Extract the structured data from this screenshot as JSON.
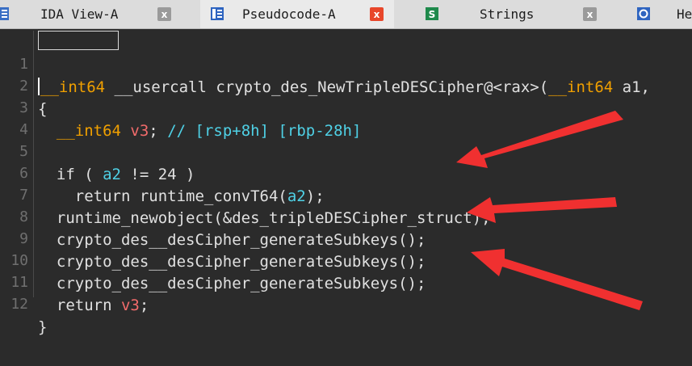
{
  "tabs": [
    {
      "label": "IDA View-A",
      "icon": "disassembly-icon",
      "close": "x",
      "active": false
    },
    {
      "label": "Pseudocode-A",
      "icon": "pseudocode-icon",
      "close": "x",
      "active": true
    },
    {
      "label": "Strings",
      "icon": "strings-icon",
      "close": "x",
      "active": false
    },
    {
      "label": "He",
      "icon": "hex-view-icon",
      "active": false
    }
  ],
  "code": {
    "lines": [
      {
        "num": "1"
      },
      {
        "num": "2",
        "text": "{"
      },
      {
        "num": "3"
      },
      {
        "num": "4"
      },
      {
        "num": "5"
      },
      {
        "num": "6"
      },
      {
        "num": "7",
        "text": "  runtime_newobject(&des_tripleDESCipher_struct);"
      },
      {
        "num": "8",
        "text": "  crypto_des__desCipher_generateSubkeys();"
      },
      {
        "num": "9",
        "text": "  crypto_des__desCipher_generateSubkeys();"
      },
      {
        "num": "10",
        "text": "  crypto_des__desCipher_generateSubkeys();"
      },
      {
        "num": "11"
      },
      {
        "num": "12",
        "text": "}"
      }
    ],
    "l1": {
      "type1": "__int64",
      "mid": " __usercall crypto_des_NewTripleDESCipher@<rax>(",
      "type2": "__int64",
      "tail": " a1,"
    },
    "l3": {
      "indent": "  ",
      "type": "__int64",
      "var": " v3",
      "semi": "; ",
      "comment": "// [rsp+8h] [rbp-28h]"
    },
    "l5": {
      "pre": "  if ( ",
      "var": "a2",
      "post": " != 24 )"
    },
    "l6": {
      "pre": "    return runtime_convT64(",
      "var": "a2",
      "post": ");"
    },
    "l11": {
      "pre": "  return ",
      "var": "v3",
      "post": ";"
    }
  },
  "colors": {
    "background": "#2b2b2b",
    "type_keyword": "#f0a000",
    "comment_and_arg": "#4fd1e6",
    "local_var": "#f26b6b",
    "arrow": "#f03030"
  }
}
